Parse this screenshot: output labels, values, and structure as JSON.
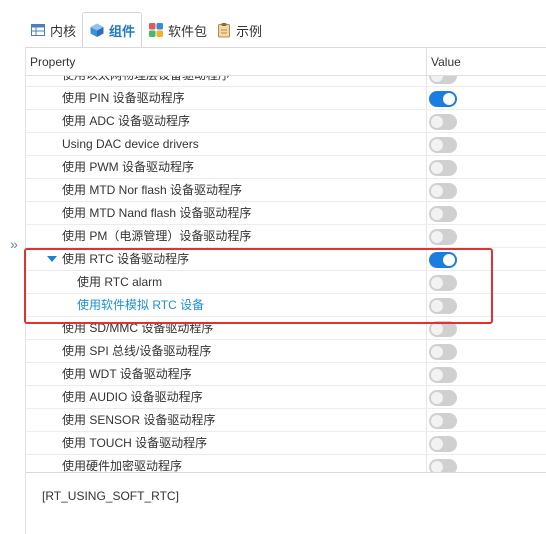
{
  "tabs": [
    {
      "label": "内核",
      "icon": "table-icon"
    },
    {
      "label": "组件",
      "icon": "cube-icon"
    },
    {
      "label": "软件包",
      "icon": "package-icon"
    },
    {
      "label": "示例",
      "icon": "clipboard-icon"
    }
  ],
  "active_tab": "组件",
  "table": {
    "headers": {
      "property": "Property",
      "value": "Value"
    },
    "rows": [
      {
        "label": "使用以太网物理层设备驱动程序",
        "on": false
      },
      {
        "label": "使用 PIN 设备驱动程序",
        "on": true
      },
      {
        "label": "使用 ADC 设备驱动程序",
        "on": false
      },
      {
        "label": "Using DAC device drivers",
        "on": false
      },
      {
        "label": "使用 PWM 设备驱动程序",
        "on": false
      },
      {
        "label": "使用 MTD Nor flash 设备驱动程序",
        "on": false
      },
      {
        "label": "使用 MTD Nand flash 设备驱动程序",
        "on": false
      },
      {
        "label": "使用 PM（电源管理）设备驱动程序",
        "on": false
      },
      {
        "label": "使用 RTC 设备驱动程序",
        "on": true,
        "expanded": true
      },
      {
        "label": "使用 RTC alarm",
        "on": false,
        "child": true
      },
      {
        "label": "使用软件模拟 RTC 设备",
        "on": false,
        "child": true,
        "selected": true
      },
      {
        "label": "使用 SD/MMC 设备驱动程序",
        "on": false
      },
      {
        "label": "使用 SPI 总线/设备驱动程序",
        "on": false
      },
      {
        "label": "使用 WDT 设备驱动程序",
        "on": false
      },
      {
        "label": "使用 AUDIO 设备驱动程序",
        "on": false
      },
      {
        "label": "使用 SENSOR 设备驱动程序",
        "on": false
      },
      {
        "label": "使用 TOUCH 设备驱动程序",
        "on": false
      },
      {
        "label": "使用硬件加密驱动程序",
        "on": false
      }
    ]
  },
  "description": "[RT_USING_SOFT_RTC]",
  "colors": {
    "accent": "#1a7ee0",
    "highlight_box": "#e03232",
    "selected_text": "#1f8fd6"
  }
}
